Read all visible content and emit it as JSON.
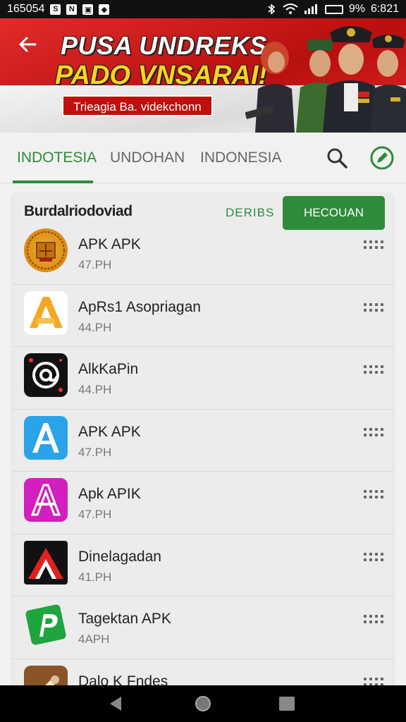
{
  "status_bar": {
    "time": "165054",
    "right_text": "9%",
    "clock": "6:821"
  },
  "banner": {
    "title_line1": "PUSA UNDREKS",
    "title_line2": "PADO VNSARAI!",
    "subtitle": "Trieagia Ba. videkchonn"
  },
  "tabs": [
    {
      "label": "INDOTESIA",
      "active": true
    },
    {
      "label": "UNDOHAN",
      "active": false
    },
    {
      "label": "INDONESIA",
      "active": false
    }
  ],
  "card": {
    "title": "Burdalriodoviad",
    "link_label": "DERIBS",
    "button_label": "HECOUAN"
  },
  "apps": [
    {
      "name": "APK APK",
      "meta": "47.PH",
      "icon": "gold-emblem-icon"
    },
    {
      "name": "ApRs1 Asopriagan",
      "meta": "44.PH",
      "icon": "orange-a-icon"
    },
    {
      "name": "AlkKaPin",
      "meta": "44.PH",
      "icon": "at-sign-icon"
    },
    {
      "name": "APK APK",
      "meta": "47.PH",
      "icon": "blue-a-icon"
    },
    {
      "name": "Apk APIK",
      "meta": "47.PH",
      "icon": "magenta-a-icon"
    },
    {
      "name": "Dinelagadan",
      "meta": "41.PH",
      "icon": "red-chevron-icon"
    },
    {
      "name": "Tagektan APK",
      "meta": "4APH",
      "icon": "green-p-icon"
    },
    {
      "name": "Dalo K Fndes",
      "meta": "",
      "icon": "brown-tool-icon"
    }
  ],
  "colors": {
    "accent": "#2e8b3a",
    "banner_red": "#c11515",
    "banner_yellow": "#ffd21f"
  }
}
